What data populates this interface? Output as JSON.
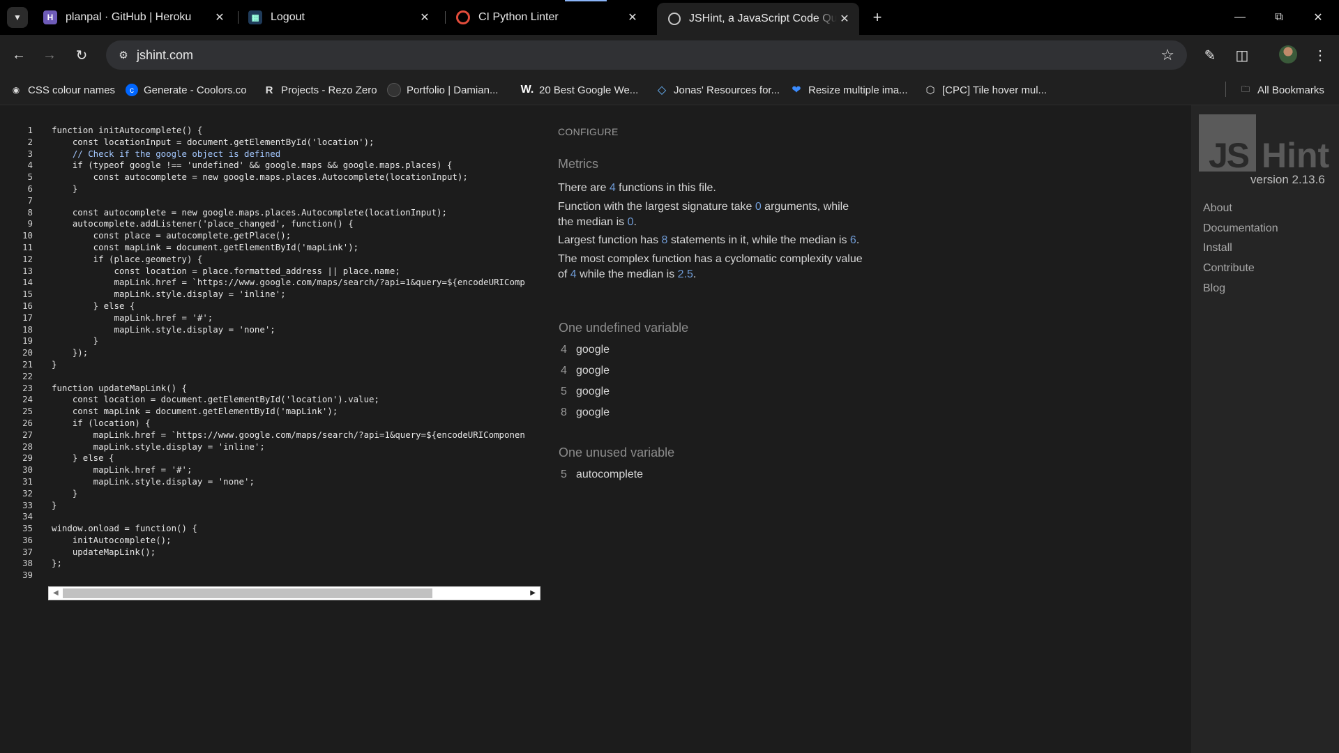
{
  "tabs": [
    {
      "title": "planpal · GitHub | Heroku",
      "favicon": "heroku-icon"
    },
    {
      "title": "Logout",
      "favicon": "django-icon"
    },
    {
      "title": "CI Python Linter",
      "favicon": "ci-icon"
    },
    {
      "title": "JSHint, a JavaScript Code Qualit",
      "favicon": "globe-icon",
      "active": true
    }
  ],
  "address": {
    "url": "jshint.com"
  },
  "bookmarks": [
    {
      "label": "CSS colour names"
    },
    {
      "label": "Generate - Coolors.co"
    },
    {
      "label": "Projects - Rezo Zero"
    },
    {
      "label": "Portfolio | Damian..."
    },
    {
      "label": "20 Best Google We..."
    },
    {
      "label": "Jonas' Resources for..."
    },
    {
      "label": "Resize multiple ima..."
    },
    {
      "label": "[CPC] Tile hover mul..."
    },
    {
      "label": "All Bookmarks"
    }
  ],
  "code_lines": [
    "function initAutocomplete() {",
    "    const locationInput = document.getElementById('location');",
    "    // Check if the google object is defined",
    "    if (typeof google !== 'undefined' && google.maps && google.maps.places) {",
    "        const autocomplete = new google.maps.places.Autocomplete(locationInput);",
    "    }",
    "",
    "    const autocomplete = new google.maps.places.Autocomplete(locationInput);",
    "    autocomplete.addListener('place_changed', function() {",
    "        const place = autocomplete.getPlace();",
    "        const mapLink = document.getElementById('mapLink');",
    "        if (place.geometry) {",
    "            const location = place.formatted_address || place.name;",
    "            mapLink.href = `https://www.google.com/maps/search/?api=1&query=${encodeURIComp",
    "            mapLink.style.display = 'inline';",
    "        } else {",
    "            mapLink.href = '#';",
    "            mapLink.style.display = 'none';",
    "        }",
    "    });",
    "}",
    "",
    "function updateMapLink() {",
    "    const location = document.getElementById('location').value;",
    "    const mapLink = document.getElementById('mapLink');",
    "    if (location) {",
    "        mapLink.href = `https://www.google.com/maps/search/?api=1&query=${encodeURIComponen",
    "        mapLink.style.display = 'inline';",
    "    } else {",
    "        mapLink.href = '#';",
    "        mapLink.style.display = 'none';",
    "    }",
    "}",
    "",
    "window.onload = function() {",
    "    initAutocomplete();",
    "    updateMapLink();",
    "};",
    ""
  ],
  "report": {
    "configure": "CONFIGURE",
    "metrics_heading": "Metrics",
    "metrics": {
      "functions_pre": "There are ",
      "functions_count": "4",
      "functions_post": " functions in this file.",
      "sig_pre": "Function with the largest signature take ",
      "sig_count": "0",
      "sig_mid": " arguments, while the median is ",
      "sig_median": "0",
      "sig_post": ".",
      "stmt_pre": "Largest function has ",
      "stmt_count": "8",
      "stmt_mid": " statements in it, while the median is ",
      "stmt_median": "6",
      "stmt_post": ".",
      "cc_pre": "The most complex function has a cyclomatic complexity value of ",
      "cc_value": "4",
      "cc_mid": " while the median is ",
      "cc_median": "2.5",
      "cc_post": "."
    },
    "undefined_heading": "One undefined variable",
    "undefined": [
      {
        "line": "4",
        "name": "google"
      },
      {
        "line": "4",
        "name": "google"
      },
      {
        "line": "5",
        "name": "google"
      },
      {
        "line": "8",
        "name": "google"
      }
    ],
    "unused_heading": "One unused variable",
    "unused": [
      {
        "line": "5",
        "name": "autocomplete"
      }
    ]
  },
  "sidebar": {
    "logo_js": "JS",
    "logo_hint": "Hint",
    "version": "version 2.13.6",
    "links": [
      "About",
      "Documentation",
      "Install",
      "Contribute",
      "Blog"
    ]
  }
}
